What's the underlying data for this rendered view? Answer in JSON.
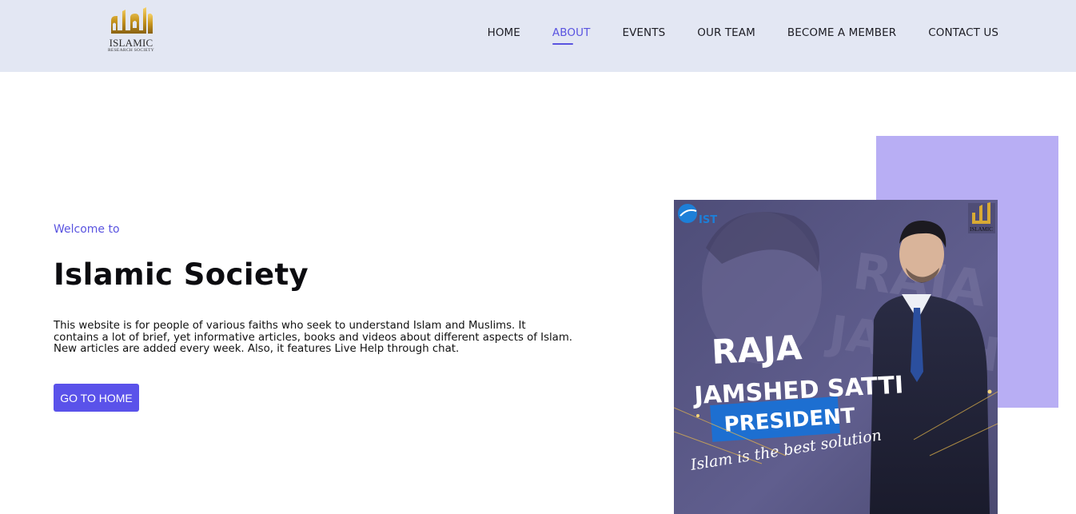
{
  "logo": {
    "name": "ISLAMIC",
    "subtitle": "RESEARCH SOCIETY"
  },
  "nav": {
    "items": [
      {
        "label": "HOME",
        "active": false
      },
      {
        "label": "ABOUT",
        "active": true
      },
      {
        "label": "EVENTS",
        "active": false
      },
      {
        "label": "OUR TEAM",
        "active": false
      },
      {
        "label": "BECOME A MEMBER",
        "active": false
      },
      {
        "label": "CONTACT US",
        "active": false
      }
    ]
  },
  "hero": {
    "welcome": "Welcome to",
    "title": "Islamic Society",
    "description": "This website is for people of various faiths who seek to understand Islam and Muslims. It contains a lot of brief, yet informative articles, books and videos about different aspects of Islam. New articles are added every week. Also, it features Live Help through chat.",
    "button_label": "GO TO HOME"
  },
  "poster": {
    "bg_text_1": "RAJA",
    "bg_text_2": "JAMSHE",
    "name_line_1": "RAJA",
    "name_line_2": "JAMSHED SATTI",
    "role": "PRESIDENT",
    "slogan": "Islam is the best solution",
    "corner_logo_text": "IST",
    "corner_society_text": "ISLAMIC"
  },
  "colors": {
    "header_bg": "#e3e7f3",
    "accent": "#5a54e0",
    "accent_rect": "#b8aef4",
    "poster_bg": "#5b5a86",
    "role_banner": "#1d6fd1"
  },
  "icons": [
    "islamic-society-logo",
    "ist-logo"
  ]
}
